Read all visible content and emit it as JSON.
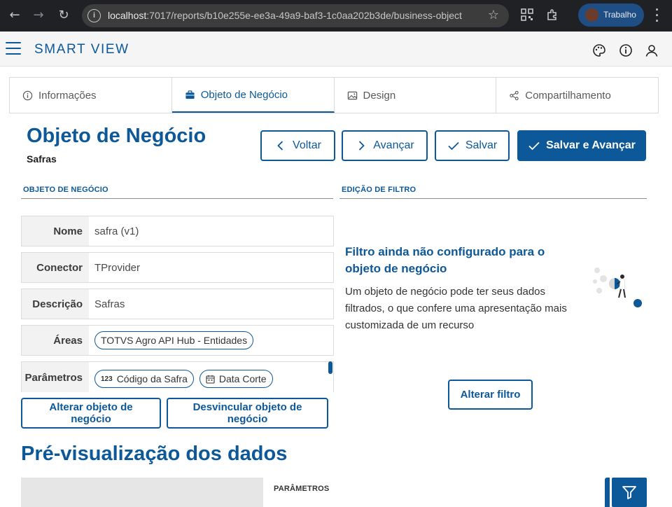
{
  "browser": {
    "url_host": "localhost",
    "url_rest": ":7017/reports/b10e255e-ee3a-49a9-baf3-1c0aa202b3de/business-object",
    "profile_label": "Trabalho"
  },
  "header": {
    "app_title": "SMART VIEW"
  },
  "tabs": [
    {
      "label": "Informações"
    },
    {
      "label": "Objeto de Negócio"
    },
    {
      "label": "Design"
    },
    {
      "label": "Compartilhamento"
    }
  ],
  "page": {
    "title": "Objeto de Negócio",
    "subtitle": "Safras"
  },
  "actions": {
    "back": "Voltar",
    "next": "Avançar",
    "save": "Salvar",
    "save_next": "Salvar e Avançar"
  },
  "business_object": {
    "section_label": "OBJETO DE NEGÓCIO",
    "rows": [
      {
        "key": "Nome",
        "value": "safra (v1)"
      },
      {
        "key": "Conector",
        "value": "TProvider"
      },
      {
        "key": "Descrição",
        "value": "Safras"
      },
      {
        "key": "Áreas",
        "chips": [
          "TOTVS Agro API Hub - Entidades"
        ]
      },
      {
        "key": "Parâmetros",
        "chips": [
          {
            "glyph": "123",
            "label": "Código da Safra"
          },
          {
            "glyph": "calendar-icon",
            "label": "Data Corte"
          }
        ]
      }
    ],
    "change_button": "Alterar objeto de negócio",
    "unlink_button": "Desvincular objeto de negócio"
  },
  "filter": {
    "section_label": "EDIÇÃO DE FILTRO",
    "empty_title": "Filtro ainda não configurado para o objeto de negócio",
    "empty_desc": "Um objeto de negócio pode ter seus dados filtrados, o que confere uma apresentação mais customizada de um recurso",
    "change_button": "Alterar filtro"
  },
  "preview": {
    "title": "Pré-visualização dos dados",
    "params_label": "PARÂMETROS"
  },
  "colors": {
    "brand": "#0c5899",
    "chrome": "#202124"
  }
}
